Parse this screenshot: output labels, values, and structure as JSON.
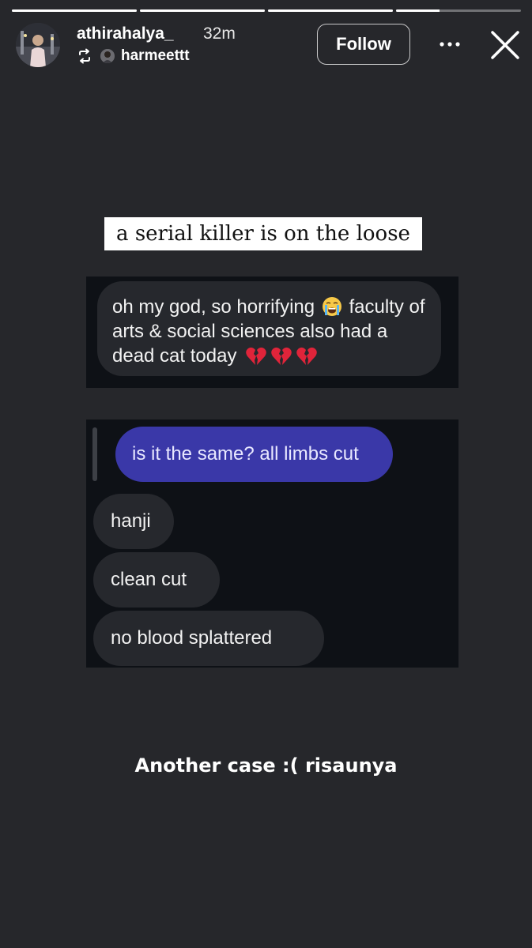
{
  "progress": {
    "segments": [
      1,
      1,
      1,
      0.35
    ]
  },
  "header": {
    "username": "athirahalya_",
    "timestamp": "32m",
    "reposted_from": "harmeettt",
    "follow_label": "Follow",
    "more_icon": "more-horizontal-icon",
    "close_icon": "close-icon",
    "repost_icon": "repost-icon"
  },
  "story": {
    "caption": "a serial killer is on the loose",
    "panel1": {
      "message_part1": "oh my god, so horrifying",
      "message_part2": "faculty of arts & social sciences also had a dead cat today",
      "emojis": [
        "loudly-crying-face",
        "broken-heart",
        "broken-heart",
        "broken-heart"
      ]
    },
    "panel2": {
      "sent_message": "is it the same? all limbs cut",
      "received": [
        "hanji",
        "clean cut",
        "no blood splattered"
      ]
    },
    "footer": "Another case :( risaunya"
  },
  "colors": {
    "background": "#26272b",
    "sent_bubble": "#3a38a8",
    "received_bubble": "#26282d",
    "panel": "#0e1116",
    "heart": "#e0243a"
  }
}
